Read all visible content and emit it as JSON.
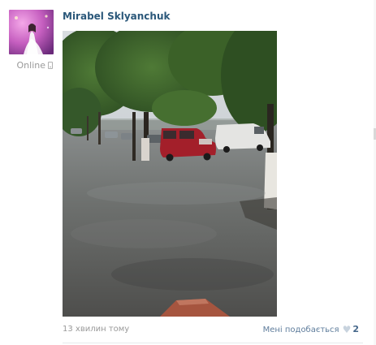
{
  "post": {
    "author": "Mirabel Sklyanchuk",
    "status": "Online",
    "status_icon": "mobile-phone-icon",
    "timestamp": "13 хвилин тому",
    "device_icon": "apple-icon",
    "like_label": "Мені подобається",
    "like_icon": "heart-icon",
    "like_count": "2",
    "photo_subject": "street-in-heavy-rain"
  },
  "colors": {
    "author_link": "#2b587a",
    "muted_text": "#999999",
    "like_text": "#5f7d9c",
    "heart": "#c8d3de"
  }
}
